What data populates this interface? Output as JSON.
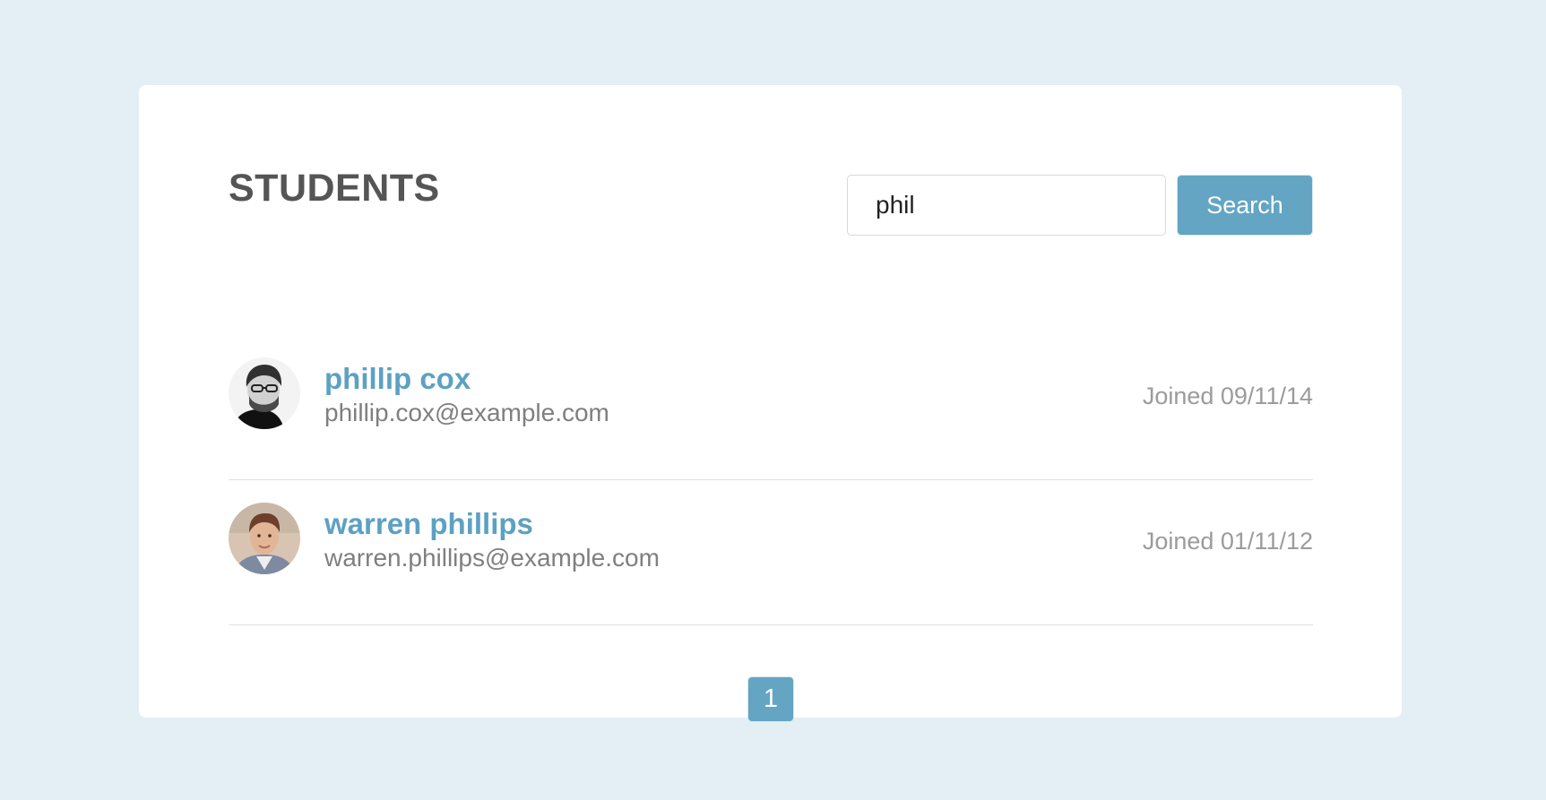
{
  "page": {
    "title": "STUDENTS"
  },
  "search": {
    "value": "phil",
    "button_label": "Search"
  },
  "students": [
    {
      "name": "phillip cox",
      "email": "phillip.cox@example.com",
      "joined": "Joined 09/11/14"
    },
    {
      "name": "warren phillips",
      "email": "warren.phillips@example.com",
      "joined": "Joined 01/11/12"
    }
  ],
  "pagination": {
    "current_page": "1"
  },
  "colors": {
    "background": "#e4eff5",
    "accent": "#63a5c3",
    "name_link": "#5da1c2",
    "title": "#555555",
    "muted_text": "#9b9b9b"
  }
}
